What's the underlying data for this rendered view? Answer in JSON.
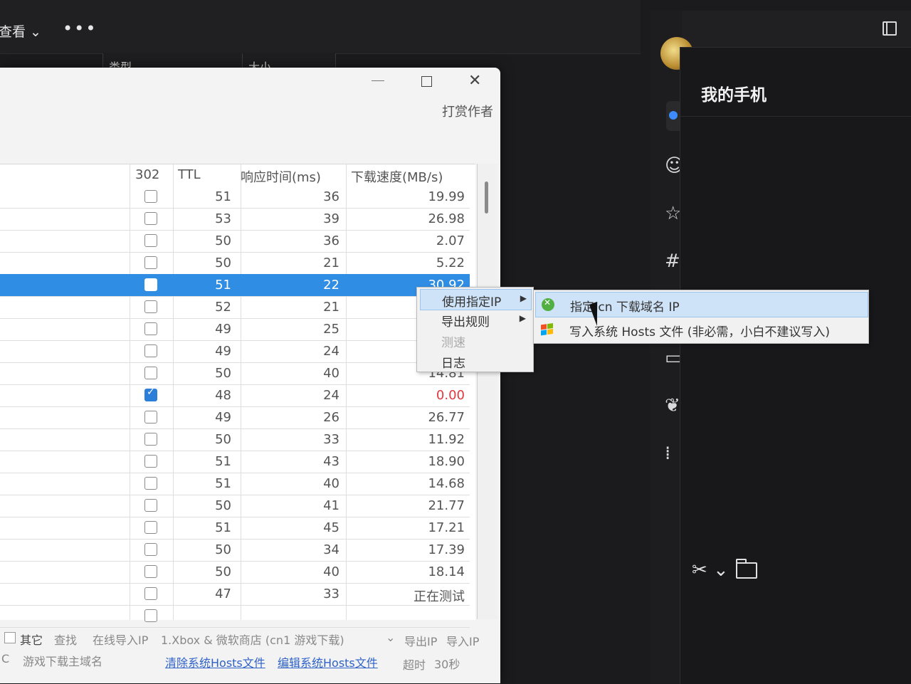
{
  "explorer": {
    "view_label": "查看",
    "more_label": "•••",
    "col_type": "类型",
    "col_size": "大小"
  },
  "phone": {
    "title": "我的手机"
  },
  "tool": {
    "tip_author": "打赏作者",
    "headers": {
      "col_302": "302",
      "col_ttl": "TTL",
      "col_resp": "响应时间(ms)",
      "col_speed": "下载速度(MB/s)"
    },
    "rows": [
      {
        "checked": false,
        "ttl": "51",
        "resp": "36",
        "speed": "19.99"
      },
      {
        "checked": false,
        "ttl": "53",
        "resp": "39",
        "speed": "26.98"
      },
      {
        "checked": false,
        "ttl": "50",
        "resp": "36",
        "speed": "2.07"
      },
      {
        "checked": false,
        "ttl": "50",
        "resp": "21",
        "speed": "5.22"
      },
      {
        "checked": false,
        "ttl": "51",
        "resp": "22",
        "speed": "30.92",
        "selected": true
      },
      {
        "checked": false,
        "ttl": "52",
        "resp": "21",
        "speed": ""
      },
      {
        "checked": false,
        "ttl": "49",
        "resp": "25",
        "speed": ""
      },
      {
        "checked": false,
        "ttl": "49",
        "resp": "24",
        "speed": ""
      },
      {
        "checked": false,
        "ttl": "50",
        "resp": "40",
        "speed": "14.81"
      },
      {
        "checked": true,
        "ttl": "48",
        "resp": "24",
        "speed": "0.00",
        "red": true
      },
      {
        "checked": false,
        "ttl": "49",
        "resp": "26",
        "speed": "26.77"
      },
      {
        "checked": false,
        "ttl": "50",
        "resp": "33",
        "speed": "11.92"
      },
      {
        "checked": false,
        "ttl": "51",
        "resp": "43",
        "speed": "18.90"
      },
      {
        "checked": false,
        "ttl": "51",
        "resp": "40",
        "speed": "14.68"
      },
      {
        "checked": false,
        "ttl": "50",
        "resp": "41",
        "speed": "21.77"
      },
      {
        "checked": false,
        "ttl": "51",
        "resp": "45",
        "speed": "17.21"
      },
      {
        "checked": false,
        "ttl": "50",
        "resp": "34",
        "speed": "17.39"
      },
      {
        "checked": false,
        "ttl": "50",
        "resp": "40",
        "speed": "18.14"
      },
      {
        "checked": false,
        "ttl": "47",
        "resp": "33",
        "speed": "正在测试"
      },
      {
        "checked": false,
        "ttl": "",
        "resp": "",
        "speed": ""
      }
    ],
    "footer": {
      "other": "其它",
      "find": "查找",
      "online_import": "在线导入IP",
      "game_select": "1.Xbox & 微软商店 (cn1 游戏下载)",
      "export_ip": "导出IP",
      "import_ip": "导入IP",
      "pc_label": "C",
      "game_domain": "游戏下载主域名",
      "clear_hosts": "清除系统Hosts文件",
      "edit_hosts": "编辑系统Hosts文件",
      "timeout": "超时",
      "timeout_value": "30秒"
    }
  },
  "context_menu": {
    "items": [
      {
        "label": "使用指定IP",
        "has_sub": true
      },
      {
        "label": "导出规则",
        "has_sub": true
      },
      {
        "label": "测速",
        "disabled": true
      },
      {
        "label": "日志"
      }
    ],
    "submenu": [
      {
        "label": "指定 cn 下载域名 IP",
        "icon": "xbox-icon"
      },
      {
        "label": "写入系统 Hosts 文件 (非必需，小白不建议写入)",
        "icon": "windows-icon"
      }
    ]
  },
  "colors": {
    "selection": "#2f8de4",
    "accent_link": "#2f62c9",
    "error_red": "#e0383e"
  }
}
